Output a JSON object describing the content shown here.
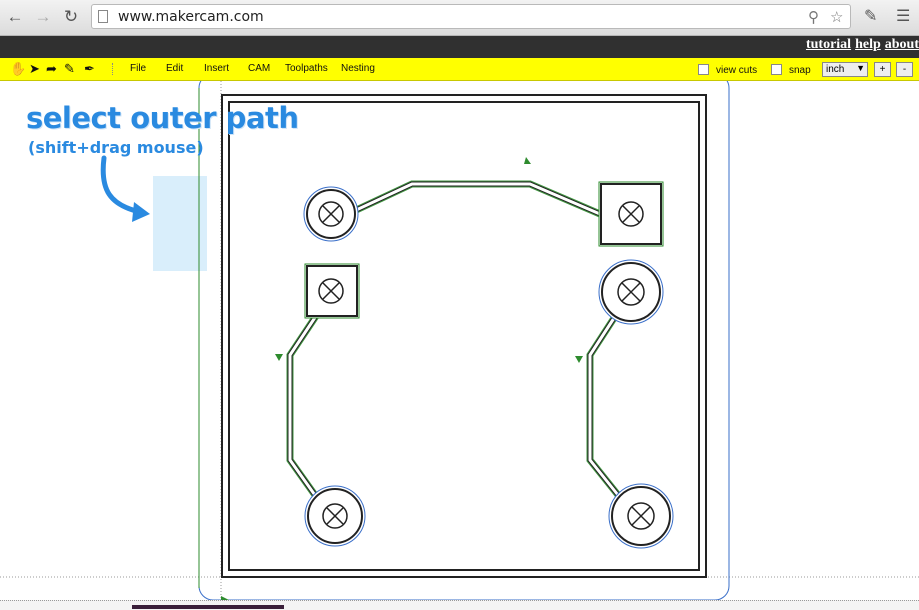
{
  "browser": {
    "url": "www.makercam.com",
    "back_icon": "arrow-left-icon",
    "forward_icon": "arrow-right-icon",
    "reload_icon": "reload-icon"
  },
  "top_links": [
    "tutorial",
    "help",
    "about"
  ],
  "toolbar": {
    "menus": [
      "File",
      "Edit",
      "Insert",
      "CAM",
      "Toolpaths",
      "Nesting"
    ],
    "view_cuts_label": "view cuts",
    "snap_label": "snap",
    "unit_value": "inch",
    "zoom_in": "+",
    "zoom_out": "-"
  },
  "annotation": {
    "title": "select outer path",
    "subtitle": "(shift+drag mouse)"
  },
  "colors": {
    "toolbar_yellow": "#ffff00",
    "annotation_blue": "#2a8ae0",
    "path_green": "#2e8b2e",
    "path_blue": "#3a6fc9"
  }
}
